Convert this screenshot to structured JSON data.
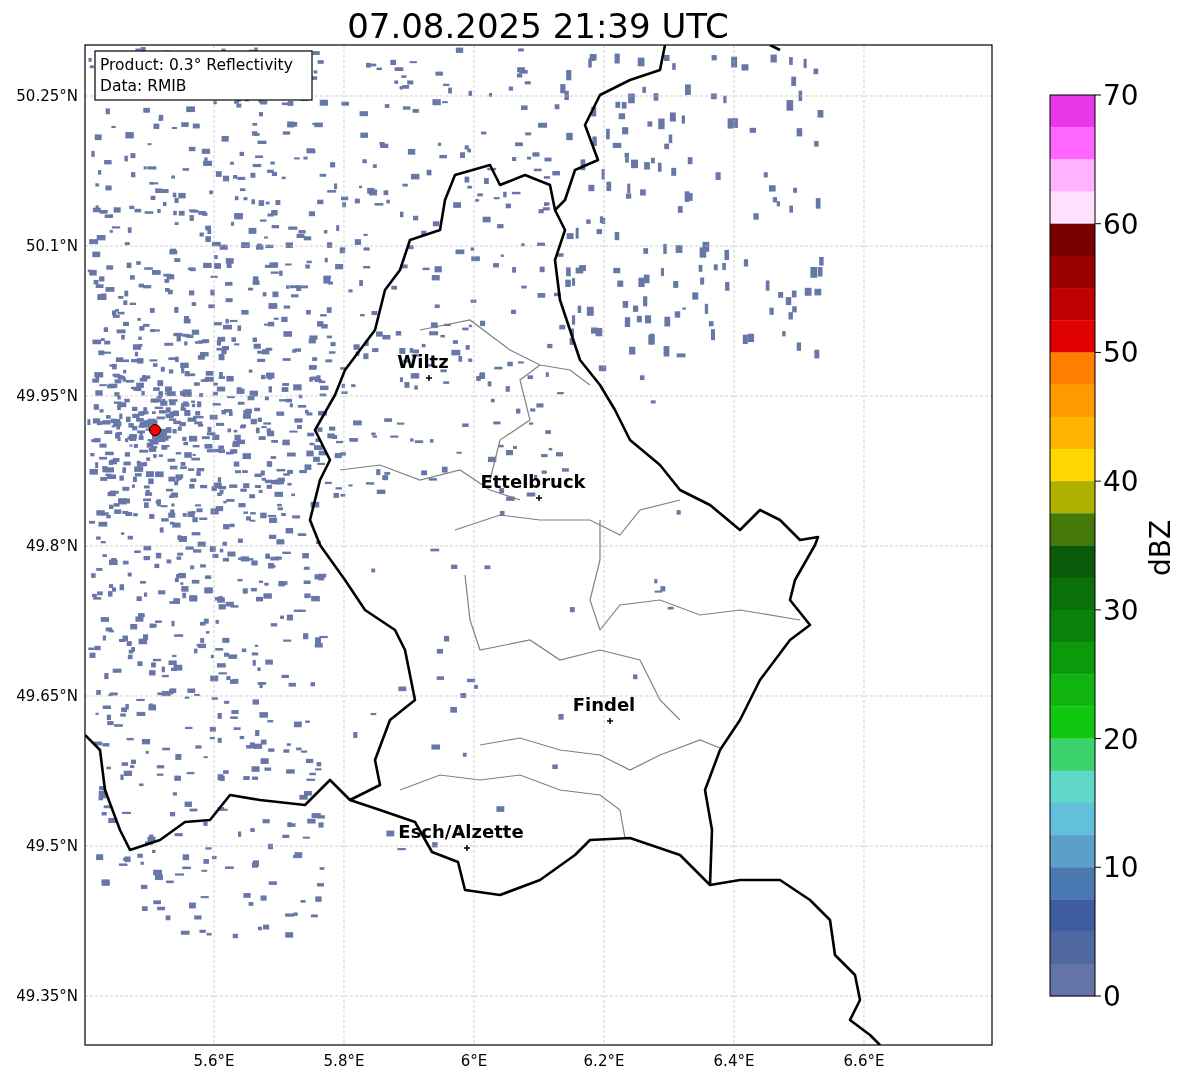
{
  "title": "07.08.2025 21:39 UTC",
  "info_box": [
    "Product: 0.3° Reflectivity",
    "Data: RMIB"
  ],
  "map": {
    "y_axis_labels": [
      "50.25°N",
      "50.1°N",
      "49.95°N",
      "49.8°N",
      "49.65°N",
      "49.5°N",
      "49.35°N"
    ],
    "x_axis_labels": [
      "5.6°E",
      "5.8°E",
      "6°E",
      "6.2°E",
      "6.4°E",
      "6.6°E"
    ],
    "cities": [
      {
        "name": "Wiltz"
      },
      {
        "name": "Ettelbruck"
      },
      {
        "name": "Findel"
      },
      {
        "name": "Esch/Alzette"
      }
    ]
  },
  "colorbar": {
    "label": "dBZ",
    "ticks": [
      "70",
      "60",
      "50",
      "40",
      "30",
      "20",
      "10",
      "0"
    ],
    "bins": [
      {
        "color": "#e838e8"
      },
      {
        "color": "#ff66ff"
      },
      {
        "color": "#ffb3ff"
      },
      {
        "color": "#ffe0ff"
      },
      {
        "color": "#780000"
      },
      {
        "color": "#9a0000"
      },
      {
        "color": "#bf0000"
      },
      {
        "color": "#e00000"
      },
      {
        "color": "#ff7f00"
      },
      {
        "color": "#ff9a00"
      },
      {
        "color": "#ffb400"
      },
      {
        "color": "#ffd700"
      },
      {
        "color": "#b0b000"
      },
      {
        "color": "#457a0a"
      },
      {
        "color": "#0a5a0a"
      },
      {
        "color": "#0a700a"
      },
      {
        "color": "#0a820a"
      },
      {
        "color": "#0a9a0a"
      },
      {
        "color": "#0fb40f"
      },
      {
        "color": "#10c810"
      },
      {
        "color": "#3cd26e"
      },
      {
        "color": "#5fd8c8"
      },
      {
        "color": "#62c0dc"
      },
      {
        "color": "#5aa0c8"
      },
      {
        "color": "#4a78b0"
      },
      {
        "color": "#405ca0"
      },
      {
        "color": "#5068a0"
      },
      {
        "color": "#6474a8"
      }
    ]
  }
}
